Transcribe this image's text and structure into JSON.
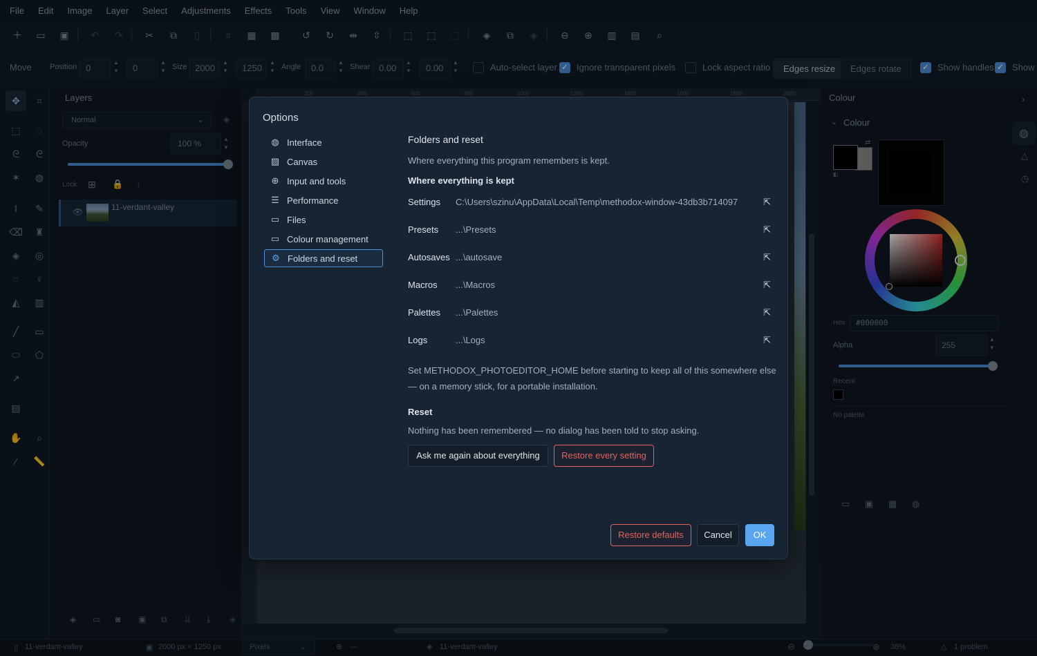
{
  "menu": [
    "File",
    "Edit",
    "Image",
    "Layer",
    "Select",
    "Adjustments",
    "Effects",
    "Tools",
    "View",
    "Window",
    "Help"
  ],
  "options_bar": {
    "tool": "Move",
    "position_label": "Position",
    "position_x": "0",
    "position_y": "0",
    "size_label": "Size",
    "size_w": "2000",
    "size_h": "1250",
    "angle_label": "Angle",
    "angle": "0.0",
    "shear_label": "Shear",
    "shear_x": "0.00",
    "shear_y": "0.00",
    "auto_select": "Auto-select layer",
    "ignore_transparent": "Ignore transparent pixels",
    "lock_aspect": "Lock aspect ratio",
    "edges_resize": "Edges resize",
    "edges_rotate": "Edges rotate",
    "show_handles": "Show handles",
    "show_trunc": "Show"
  },
  "layers_panel": {
    "title": "Layers",
    "blend_mode": "Normal",
    "opacity_label": "Opacity",
    "opacity_value": "100 %",
    "opacity_fraction": 1.0,
    "lock_label": "Lock",
    "layer_name": "11-verdant-valley"
  },
  "ruler_ticks": [
    "200",
    "400",
    "600",
    "800",
    "1000",
    "1200",
    "1400",
    "1600",
    "1800",
    "2000"
  ],
  "colour_panel": {
    "title": "Colour",
    "section": "Colour",
    "hex_label": "Hex",
    "hex_value": "#000000",
    "alpha_label": "Alpha",
    "alpha_value": "255",
    "recent_label": "Recent",
    "no_palette": "No palette"
  },
  "statusbar": {
    "document": "11-verdant-valley",
    "dimensions": "2000 px × 1250 px",
    "units": "Pixels",
    "cursor": "—",
    "layer": "11-verdant-valley",
    "zoom": "38%",
    "problems": "1 problem"
  },
  "dialog": {
    "title": "Options",
    "nav": [
      {
        "label": "Interface",
        "icon": "palette-icon"
      },
      {
        "label": "Canvas",
        "icon": "image-icon"
      },
      {
        "label": "Input and tools",
        "icon": "target-icon"
      },
      {
        "label": "Performance",
        "icon": "sliders-icon"
      },
      {
        "label": "Files",
        "icon": "folder-icon"
      },
      {
        "label": "Colour management",
        "icon": "monitor-icon"
      },
      {
        "label": "Folders and reset",
        "icon": "gear-icon"
      }
    ],
    "heading": "Folders and reset",
    "description": "Where everything this program remembers is kept.",
    "where_heading": "Where everything is kept",
    "folders": [
      {
        "key": "Settings",
        "value": "C:\\Users\\szinu\\AppData\\Local\\Temp\\methodox-window-43db3b714097"
      },
      {
        "key": "Presets",
        "value": "...\\Presets"
      },
      {
        "key": "Autosaves",
        "value": "...\\autosave"
      },
      {
        "key": "Macros",
        "value": "...\\Macros"
      },
      {
        "key": "Palettes",
        "value": "...\\Palettes"
      },
      {
        "key": "Logs",
        "value": "...\\Logs"
      }
    ],
    "note_line1": "Set METHODOX_PHOTOEDITOR_HOME before starting to keep all of this somewhere else",
    "note_line2": "— on a memory stick, for a portable installation.",
    "reset_heading": "Reset",
    "reset_desc": "Nothing has been remembered — no dialog has been told to stop asking.",
    "ask_again": "Ask me again about everything",
    "restore_every": "Restore every setting",
    "restore_defaults": "Restore defaults",
    "cancel": "Cancel",
    "ok": "OK"
  },
  "colors": {
    "accent": "#4a8fd6",
    "danger": "#e0645e",
    "ok_bg": "#5aa5ef"
  }
}
